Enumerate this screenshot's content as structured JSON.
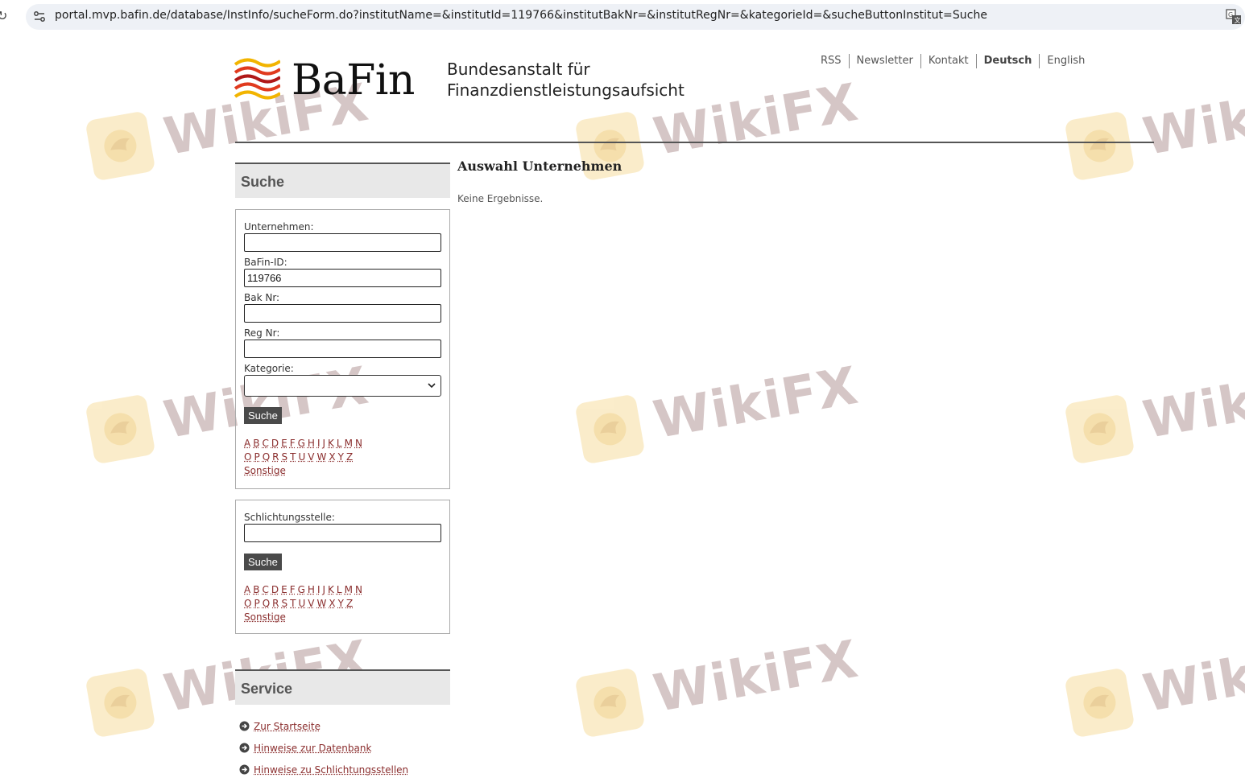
{
  "browser": {
    "url": "portal.mvp.bafin.de/database/InstInfo/sucheForm.do?institutName=&institutId=119766&institutBakNr=&institutRegNr=&kategorieId=&sucheButtonInstitut=Suche"
  },
  "header": {
    "logo_text": "BaFin",
    "agency_line1": "Bundesanstalt für",
    "agency_line2": "Finanzdienstleistungsaufsicht",
    "top_links": [
      "RSS",
      "Newsletter",
      "Kontakt",
      "Deutsch",
      "English"
    ]
  },
  "sidebar": {
    "search_heading": "Suche",
    "form1": {
      "company_label": "Unternehmen:",
      "company_value": "",
      "bafin_id_label": "BaFin-ID:",
      "bafin_id_value": "119766",
      "bak_label": "Bak Nr:",
      "bak_value": "",
      "reg_label": "Reg Nr:",
      "reg_value": "",
      "category_label": "Kategorie:",
      "category_value": "",
      "button": "Suche"
    },
    "alphabet_row1": [
      "A",
      "B",
      "C",
      "D",
      "E",
      "F",
      "G",
      "H",
      "I",
      "J",
      "K",
      "L",
      "M",
      "N"
    ],
    "alphabet_row2": [
      "O",
      "P",
      "Q",
      "R",
      "S",
      "T",
      "U",
      "V",
      "W",
      "X",
      "Y",
      "Z"
    ],
    "other": "Sonstige",
    "form2": {
      "arbitration_label": "Schlichtungsstelle:",
      "arbitration_value": "",
      "button": "Suche"
    },
    "service_heading": "Service",
    "service_links": [
      "Zur Startseite",
      "Hinweise zur Datenbank",
      "Hinweise zu Schlichtungsstellen"
    ]
  },
  "main": {
    "title": "Auswahl Unternehmen",
    "message": "Keine Ergebnisse."
  },
  "watermark": {
    "text": "WikiFX"
  },
  "colors": {
    "link": "#8a2d2d",
    "button": "#4a4a4a",
    "heading_bg": "#e8e8e8"
  }
}
